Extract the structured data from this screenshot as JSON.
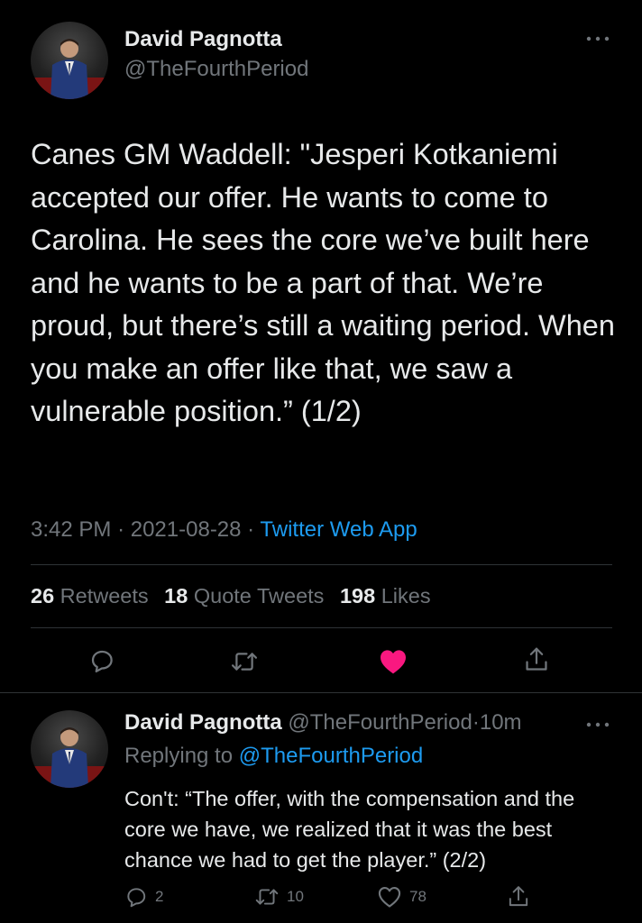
{
  "main_tweet": {
    "author_name": "David Pagnotta",
    "author_handle": "@TheFourthPeriod",
    "text": "Canes GM Waddell: \"Jesperi Kotkaniemi accepted our offer. He wants to come to Carolina. He sees the core we’ve built here and he wants to be a part of that. We’re proud, but there’s still a waiting period. When you make an offer like that, we saw a vulnerable position.” (1/2)",
    "time": "3:42 PM",
    "date": "2021-08-28",
    "separator": "·",
    "source": "Twitter Web App",
    "retweets_count": "26",
    "retweets_label": "Retweets",
    "quotes_count": "18",
    "quotes_label": "Quote Tweets",
    "likes_count": "198",
    "likes_label": "Likes",
    "liked": true
  },
  "reply_tweet": {
    "author_name": "David Pagnotta",
    "author_handle": "@TheFourthPeriod",
    "separator": "·",
    "age": "10m",
    "replying_prefix": "Replying to",
    "replying_to": "@TheFourthPeriod",
    "text": "Con't: “The offer, with the compensation and the core we have, we realized that it was the best chance we had to get the player.” (2/2)",
    "reply_count": "2",
    "retweet_count": "10",
    "like_count": "78"
  },
  "colors": {
    "background": "#000000",
    "text": "#e7e9ea",
    "secondary": "#71767b",
    "link": "#1d9bf0",
    "like": "#f91880",
    "divider": "#2f3336"
  },
  "icons": [
    "more-icon",
    "reply-icon",
    "retweet-icon",
    "like-icon",
    "share-icon"
  ]
}
